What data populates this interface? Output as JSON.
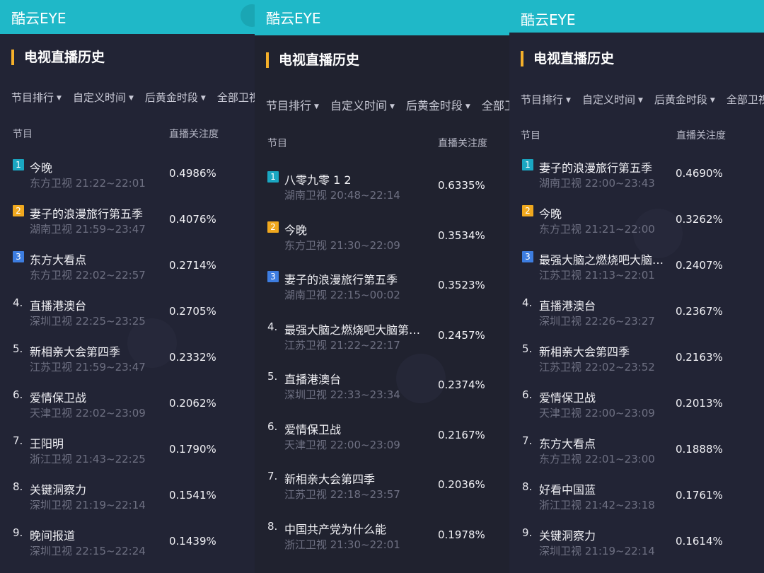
{
  "badge_colors": {
    "1": "#1aa7c2",
    "2": "#f0a81e",
    "3": "#3d7de0"
  },
  "panels": [
    {
      "app_title": "酷云EYE",
      "section_title": "电视直播历史",
      "filters": [
        "节目排行",
        "自定义时间",
        "后黄金时段",
        "全部卫视"
      ],
      "columns": {
        "program": "节目",
        "value": "直播关注度"
      },
      "rows": [
        {
          "rank": "1",
          "name": "今晚",
          "sub": "东方卫视 21:22~22:01",
          "value": "0.4986%"
        },
        {
          "rank": "2",
          "name": "妻子的浪漫旅行第五季",
          "sub": "湖南卫视 21:59~23:47",
          "value": "0.4076%"
        },
        {
          "rank": "3",
          "name": "东方大看点",
          "sub": "东方卫视 22:02~22:57",
          "value": "0.2714%"
        },
        {
          "rank": "4.",
          "name": "直播港澳台",
          "sub": "深圳卫视 22:25~23:25",
          "value": "0.2705%"
        },
        {
          "rank": "5.",
          "name": "新相亲大会第四季",
          "sub": "江苏卫视 21:59~23:47",
          "value": "0.2332%"
        },
        {
          "rank": "6.",
          "name": "爱情保卫战",
          "sub": "天津卫视 22:02~23:09",
          "value": "0.2062%"
        },
        {
          "rank": "7.",
          "name": "王阳明",
          "sub": "浙江卫视 21:43~22:25",
          "value": "0.1790%"
        },
        {
          "rank": "8.",
          "name": "关键洞察力",
          "sub": "深圳卫视 21:19~22:14",
          "value": "0.1541%"
        },
        {
          "rank": "9.",
          "name": "晚间报道",
          "sub": "深圳卫视 22:15~22:24",
          "value": "0.1439%"
        }
      ]
    },
    {
      "app_title": "酷云EYE",
      "section_title": "电视直播历史",
      "filters": [
        "节目排行",
        "自定义时间",
        "后黄金时段",
        "全部卫视"
      ],
      "columns": {
        "program": "节目",
        "value": "直播关注度"
      },
      "rows": [
        {
          "rank": "1",
          "name": "八零九零 1 2",
          "sub": "湖南卫视 20:48~22:14",
          "value": "0.6335%"
        },
        {
          "rank": "2",
          "name": "今晚",
          "sub": "东方卫视 21:30~22:09",
          "value": "0.3534%"
        },
        {
          "rank": "3",
          "name": "妻子的浪漫旅行第五季",
          "sub": "湖南卫视 22:15~00:02",
          "value": "0.3523%"
        },
        {
          "rank": "4.",
          "name": "最强大脑之燃烧吧大脑第…",
          "sub": "江苏卫视 21:22~22:17",
          "value": "0.2457%"
        },
        {
          "rank": "5.",
          "name": "直播港澳台",
          "sub": "深圳卫视 22:33~23:34",
          "value": "0.2374%"
        },
        {
          "rank": "6.",
          "name": "爱情保卫战",
          "sub": "天津卫视 22:00~23:09",
          "value": "0.2167%"
        },
        {
          "rank": "7.",
          "name": "新相亲大会第四季",
          "sub": "江苏卫视 22:18~23:57",
          "value": "0.2036%"
        },
        {
          "rank": "8.",
          "name": "中国共产党为什么能",
          "sub": "浙江卫视 21:30~22:01",
          "value": "0.1978%"
        }
      ]
    },
    {
      "app_title": "酷云EYE",
      "section_title": "电视直播历史",
      "filters": [
        "节目排行",
        "自定义时间",
        "后黄金时段",
        "全部卫视"
      ],
      "columns": {
        "program": "节目",
        "value": "直播关注度"
      },
      "rows": [
        {
          "rank": "1",
          "name": "妻子的浪漫旅行第五季",
          "sub": "湖南卫视 22:00~23:43",
          "value": "0.4690%"
        },
        {
          "rank": "2",
          "name": "今晚",
          "sub": "东方卫视 21:21~22:00",
          "value": "0.3262%"
        },
        {
          "rank": "3",
          "name": "最强大脑之燃烧吧大脑第…",
          "sub": "江苏卫视 21:13~22:01",
          "value": "0.2407%"
        },
        {
          "rank": "4.",
          "name": "直播港澳台",
          "sub": "深圳卫视 22:26~23:27",
          "value": "0.2367%"
        },
        {
          "rank": "5.",
          "name": "新相亲大会第四季",
          "sub": "江苏卫视 22:02~23:52",
          "value": "0.2163%"
        },
        {
          "rank": "6.",
          "name": "爱情保卫战",
          "sub": "天津卫视 22:00~23:09",
          "value": "0.2013%"
        },
        {
          "rank": "7.",
          "name": "东方大看点",
          "sub": "东方卫视 22:01~23:00",
          "value": "0.1888%"
        },
        {
          "rank": "8.",
          "name": "好看中国蓝",
          "sub": "浙江卫视 21:42~23:18",
          "value": "0.1761%"
        },
        {
          "rank": "9.",
          "name": "关键洞察力",
          "sub": "深圳卫视 21:19~22:14",
          "value": "0.1614%"
        }
      ]
    }
  ]
}
